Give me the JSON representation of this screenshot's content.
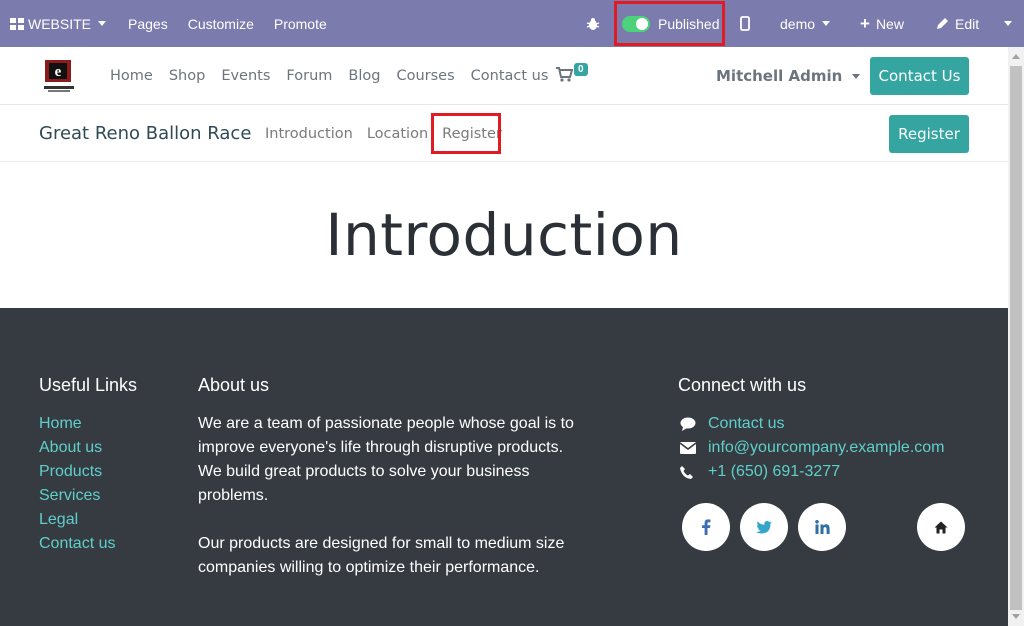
{
  "adminbar": {
    "website_label": "WEBSITE",
    "pages": "Pages",
    "customize": "Customize",
    "promote": "Promote",
    "published_label": "Published",
    "published_state": true,
    "demo_label": "demo",
    "new_label": "New",
    "edit_label": "Edit",
    "bar_color": "#7c7bad"
  },
  "sitenav": {
    "links": [
      "Home",
      "Shop",
      "Events",
      "Forum",
      "Blog",
      "Courses",
      "Contact us"
    ],
    "cart_count": "0",
    "user_name": "Mitchell Admin",
    "contact_button": "Contact Us"
  },
  "event": {
    "title": "Great Reno Ballon Race",
    "links": [
      "Introduction",
      "Location",
      "Register"
    ],
    "register_button": "Register"
  },
  "main": {
    "heading": "Introduction"
  },
  "footer": {
    "useful_links_title": "Useful Links",
    "useful_links": [
      "Home",
      "About us",
      "Products",
      "Services",
      "Legal",
      "Contact us"
    ],
    "about_title": "About us",
    "about_p1": "We are a team of passionate people whose goal is to improve everyone's life through disruptive products. We build great products to solve your business problems.",
    "about_p2": "Our products are designed for small to medium size companies willing to optimize their performance.",
    "connect_title": "Connect with us",
    "contact_link": "Contact us",
    "email": "info@yourcompany.example.com",
    "phone": "+1 (650) 691-3277",
    "social_icons": [
      "facebook-icon",
      "twitter-icon",
      "linkedin-icon",
      "home-icon"
    ]
  },
  "colors": {
    "accent_teal": "#35a5a2",
    "footer_bg": "#363b42",
    "link_teal": "#5fcfca",
    "highlight_red": "#e01b24"
  }
}
